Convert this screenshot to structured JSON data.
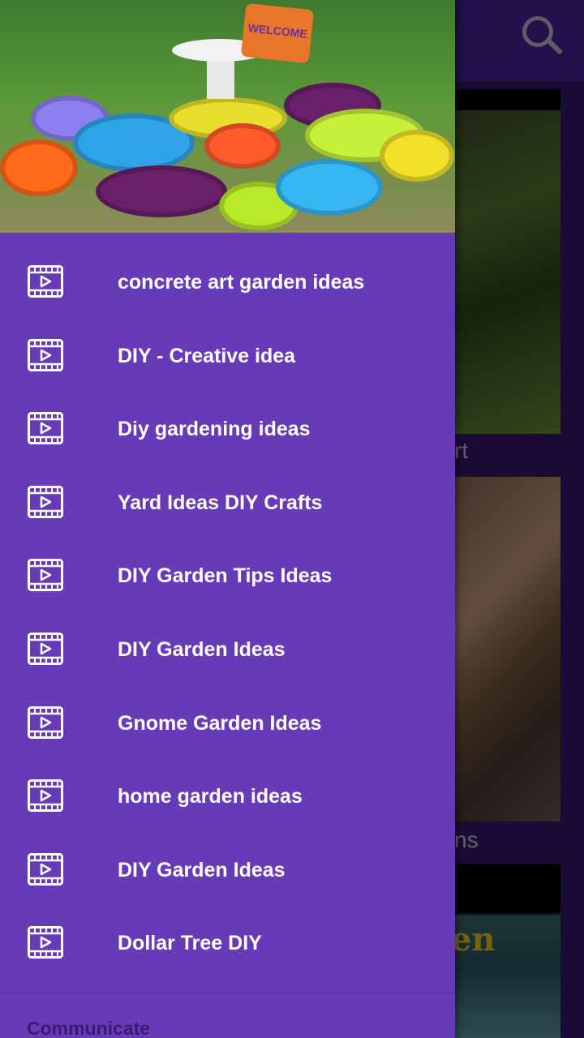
{
  "background": {
    "search_icon": "search-icon",
    "card_titles": [
      "rt",
      "ns"
    ],
    "card3_overlay_text": "en"
  },
  "drawer": {
    "header_image": "tire-garden-header-image",
    "header_sign_text": "WELCOME",
    "items": [
      {
        "label": "concrete art garden ideas",
        "icon": "video-icon"
      },
      {
        "label": "DIY - Creative idea",
        "icon": "video-icon"
      },
      {
        "label": "Diy gardening ideas",
        "icon": "video-icon"
      },
      {
        "label": "Yard Ideas DIY Crafts",
        "icon": "video-icon"
      },
      {
        "label": "DIY Garden Tips Ideas",
        "icon": "video-icon"
      },
      {
        "label": "DIY Garden Ideas",
        "icon": "video-icon"
      },
      {
        "label": "Gnome Garden Ideas",
        "icon": "video-icon"
      },
      {
        "label": "home garden ideas",
        "icon": "video-icon"
      },
      {
        "label": "DIY Garden Ideas",
        "icon": "video-icon"
      },
      {
        "label": "Dollar Tree DIY",
        "icon": "video-icon"
      }
    ],
    "section_title": "Communicate"
  },
  "colors": {
    "drawer_bg": "#673ab7",
    "toolbar_bg": "#4a23a0",
    "item_text": "#ffffff"
  }
}
